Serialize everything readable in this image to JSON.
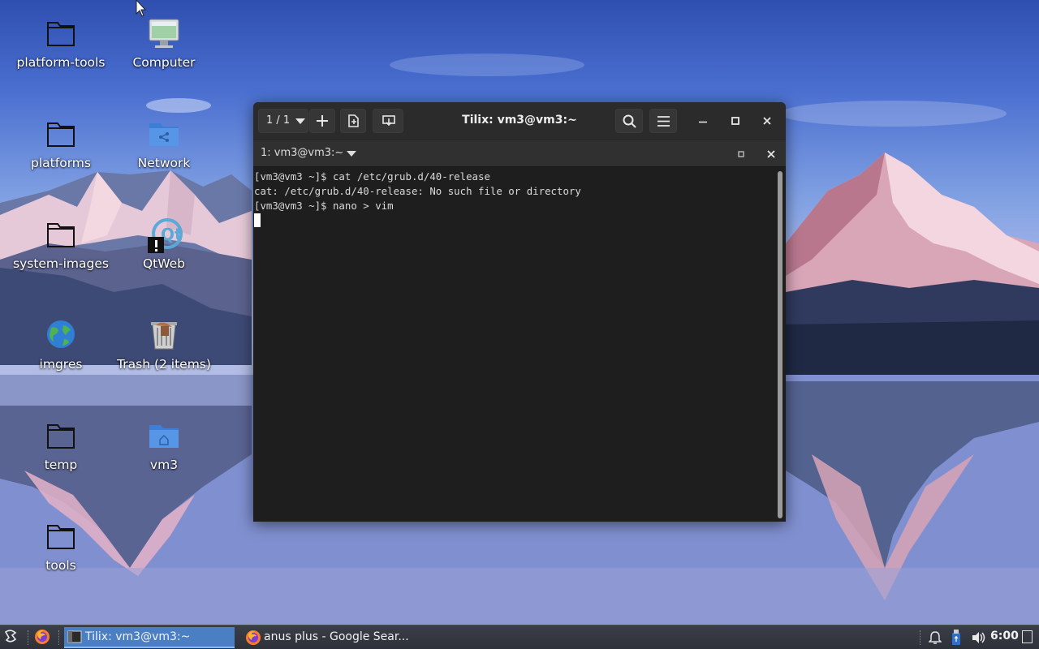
{
  "desktop": {
    "icons": [
      {
        "label": "platform-tools",
        "icon": "folder-icon"
      },
      {
        "label": "Computer",
        "icon": "computer-icon"
      },
      {
        "label": "platforms",
        "icon": "folder-icon"
      },
      {
        "label": "Network",
        "icon": "network-folder-icon"
      },
      {
        "label": "system-images",
        "icon": "folder-icon"
      },
      {
        "label": "QtWeb",
        "icon": "qtweb-icon"
      },
      {
        "label": "imgres",
        "icon": "globe-icon"
      },
      {
        "label": "Trash (2 items)",
        "icon": "trash-icon"
      },
      {
        "label": "temp",
        "icon": "folder-icon"
      },
      {
        "label": "vm3",
        "icon": "home-folder-icon"
      },
      {
        "label": "tools",
        "icon": "folder-icon"
      }
    ]
  },
  "tilix": {
    "title": "Tilix: vm3@vm3:~",
    "session_counter": "1 / 1",
    "session_title": "1: vm3@vm3:~",
    "terminal_lines": [
      "[vm3@vm3 ~]$ cat /etc/grub.d/40-release",
      "cat: /etc/grub.d/40-release: No such file or directory",
      "[vm3@vm3 ~]$ nano > vim"
    ]
  },
  "taskbar": {
    "tasks": [
      {
        "label": "Tilix: vm3@vm3:~",
        "icon": "terminal-icon",
        "active": true
      },
      {
        "label": "anus plus - Google Sear...",
        "icon": "firefox-icon",
        "active": false
      }
    ],
    "clock": "6:00"
  },
  "colors": {
    "terminal_bg": "#1e1e1e",
    "titlebar_bg": "#2b2b2b",
    "taskbar_active": "#4a7fc4",
    "folder_blue": "#3d7fd6"
  }
}
